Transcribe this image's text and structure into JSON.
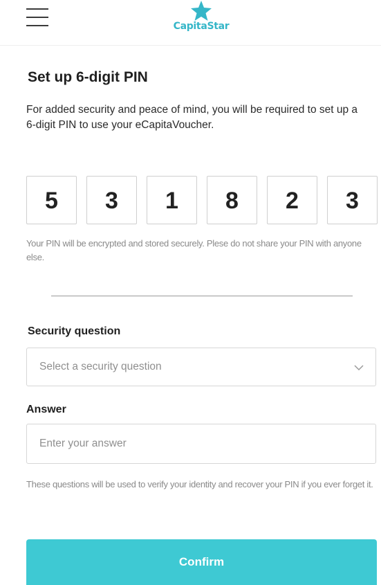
{
  "header": {
    "logo_text": "CapitaStar",
    "brand_color": "#35b6c8"
  },
  "main": {
    "title": "Set up 6-digit PIN",
    "description": "For added security and peace of mind, you will be required to set up a 6-digit PIN to use your eCapitaVoucher.",
    "pin_digits": [
      "5",
      "3",
      "1",
      "8",
      "2",
      "3"
    ],
    "pin_note": "Your PIN will be encrypted and stored securely. Plese do not share your PIN with anyone else."
  },
  "security": {
    "question_label": "Security question",
    "question_placeholder": "Select a security question",
    "answer_label": "Answer",
    "answer_placeholder": "Enter your answer",
    "help_text": "These questions will be used to verify your identity and recover your PIN if you ever forget it."
  },
  "actions": {
    "confirm_label": "Confirm",
    "confirm_color": "#3ec9d3"
  }
}
